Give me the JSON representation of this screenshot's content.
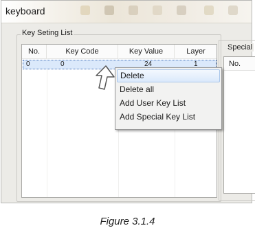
{
  "window": {
    "title": "keyboard"
  },
  "key_list": {
    "label": "Key Seting List",
    "columns": [
      "No.",
      "Key Code",
      "Key Value",
      "Layer"
    ],
    "rows": [
      {
        "no": "0",
        "code": "0",
        "value": "24",
        "layer": "1"
      }
    ]
  },
  "special_list": {
    "label": "Special",
    "columns": [
      "No."
    ]
  },
  "context_menu": {
    "items": [
      "Delete",
      "Delete all",
      "Add User Key List",
      "Add Special Key List"
    ],
    "hovered_index": 0
  },
  "caption": "Figure 3.1.4",
  "colors": {
    "selection": "#dbe9fb",
    "menu_bg": "#f2f2f1",
    "window_bg": "#ecebe7"
  },
  "icons": [
    "cursor-arrow-icon"
  ]
}
